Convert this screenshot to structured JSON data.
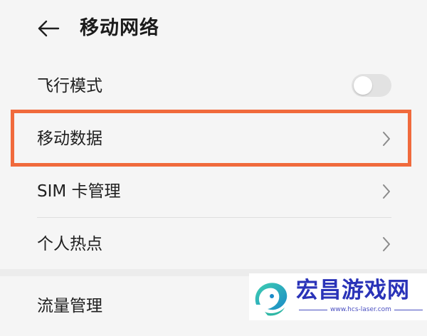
{
  "header": {
    "back_icon": "arrow-left-icon",
    "title": "移动网络"
  },
  "settings": {
    "airplane_mode": {
      "label": "飞行模式",
      "toggle_on": false,
      "icon": "toggle-switch-icon"
    },
    "mobile_data": {
      "label": "移动数据",
      "icon": "chevron-right-icon",
      "highlighted": true
    },
    "sim_management": {
      "label": "SIM 卡管理",
      "icon": "chevron-right-icon"
    },
    "hotspot": {
      "label": "个人热点",
      "icon": "chevron-right-icon"
    },
    "traffic_management": {
      "label": "流量管理"
    }
  },
  "watermark": {
    "brand": "宏昌游戏网",
    "url": "www.hcs-laser.com",
    "logo_icon": "swirl-logo-icon"
  },
  "colors": {
    "highlight_border": "#f06a3c",
    "brand_text": "#2a33b8",
    "background": "#f5f5f5"
  }
}
